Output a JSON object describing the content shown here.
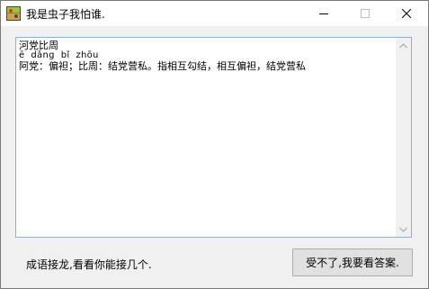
{
  "window": {
    "title": "我是虫子我怕谁.",
    "icon": "app-icon",
    "controls": {
      "minimize_icon": "minimize-icon",
      "maximize_icon": "maximize-icon",
      "close_icon": "close-icon"
    }
  },
  "textarea": {
    "idiom": "河党比周",
    "pinyin": "ē  dǎng  bǐ  zhōu",
    "explanation": "阿党：偏袒；比周：结党营私。指相互勾结，相互偏袒，结党营私",
    "scroll_up_icon": "scroll-up-arrow-icon",
    "scroll_down_icon": "scroll-down-arrow-icon"
  },
  "footer": {
    "status_text": "成语接龙,看看你能接几个.",
    "answer_button_label": "受不了,我要看答案."
  },
  "colors": {
    "window_bg": "#f0f0f0",
    "textarea_border": "#7eb4ea",
    "button_bg": "#e1e1e1",
    "button_border": "#adadad"
  }
}
